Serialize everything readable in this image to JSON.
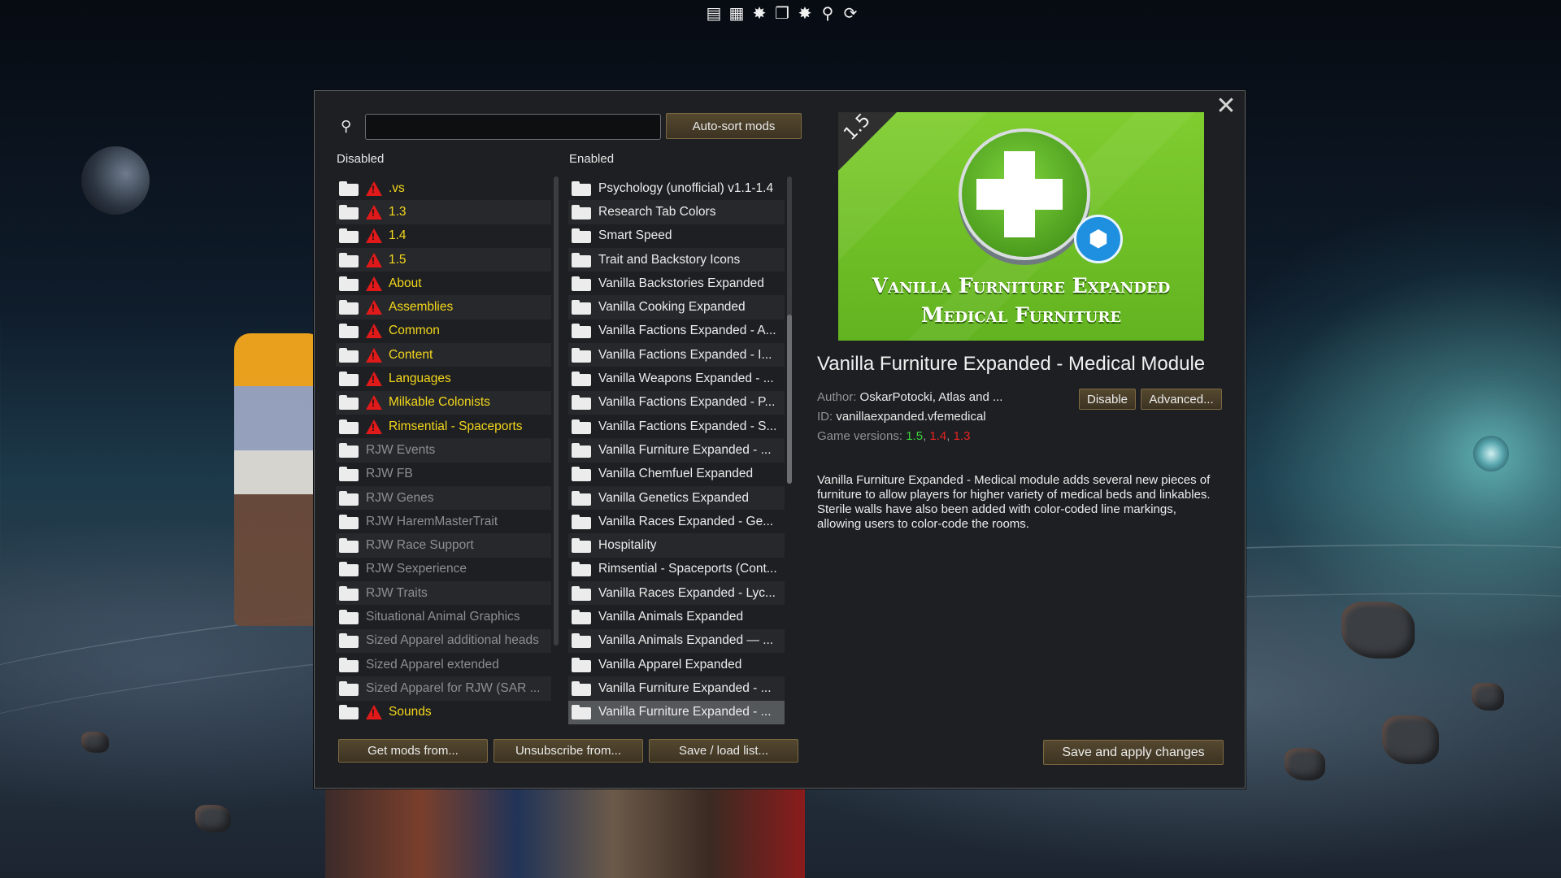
{
  "top_toolbar": {
    "icons": [
      "list-icon",
      "grid-icon",
      "gear-burst-icon",
      "copy-icon",
      "gear-burst-icon",
      "search-icon",
      "refresh-icon"
    ]
  },
  "search": {
    "value": "",
    "placeholder": ""
  },
  "buttons": {
    "auto_sort": "Auto-sort mods",
    "get_mods": "Get mods from...",
    "unsubscribe": "Unsubscribe from...",
    "save_load": "Save / load list...",
    "disable": "Disable",
    "advanced": "Advanced...",
    "save_apply": "Save and apply changes"
  },
  "columns": {
    "disabled_header": "Disabled",
    "enabled_header": "Enabled"
  },
  "disabled_mods": [
    {
      "name": ".vs",
      "warning": true
    },
    {
      "name": "1.3",
      "warning": true
    },
    {
      "name": "1.4",
      "warning": true
    },
    {
      "name": "1.5",
      "warning": true
    },
    {
      "name": "About",
      "warning": true
    },
    {
      "name": "Assemblies",
      "warning": true
    },
    {
      "name": "Common",
      "warning": true
    },
    {
      "name": "Content",
      "warning": true
    },
    {
      "name": "Languages",
      "warning": true
    },
    {
      "name": "Milkable Colonists",
      "warning": true
    },
    {
      "name": "Rimsential - Spaceports",
      "warning": true
    },
    {
      "name": "RJW Events",
      "warning": false
    },
    {
      "name": "RJW FB",
      "warning": false
    },
    {
      "name": "RJW Genes",
      "warning": false
    },
    {
      "name": "RJW HaremMasterTrait",
      "warning": false
    },
    {
      "name": "RJW Race Support",
      "warning": false
    },
    {
      "name": "RJW Sexperience",
      "warning": false
    },
    {
      "name": "RJW Traits",
      "warning": false
    },
    {
      "name": "Situational Animal Graphics",
      "warning": false
    },
    {
      "name": "Sized Apparel additional heads",
      "warning": false
    },
    {
      "name": "Sized Apparel extended",
      "warning": false
    },
    {
      "name": "Sized Apparel for RJW (SAR ...",
      "warning": false
    },
    {
      "name": "Sounds",
      "warning": true
    }
  ],
  "enabled_mods": [
    {
      "name": "Psychology (unofficial) v1.1-1.4"
    },
    {
      "name": "Research Tab Colors"
    },
    {
      "name": "Smart Speed"
    },
    {
      "name": "Trait and Backstory Icons"
    },
    {
      "name": "Vanilla Backstories Expanded"
    },
    {
      "name": "Vanilla Cooking Expanded"
    },
    {
      "name": "Vanilla Factions Expanded - A..."
    },
    {
      "name": "Vanilla Factions Expanded - I..."
    },
    {
      "name": "Vanilla Weapons Expanded - ..."
    },
    {
      "name": "Vanilla Factions Expanded - P..."
    },
    {
      "name": "Vanilla Factions Expanded - S..."
    },
    {
      "name": "Vanilla Furniture Expanded - ..."
    },
    {
      "name": "Vanilla Chemfuel Expanded"
    },
    {
      "name": "Vanilla Genetics Expanded"
    },
    {
      "name": "Vanilla Races Expanded - Ge..."
    },
    {
      "name": "Hospitality"
    },
    {
      "name": "Rimsential - Spaceports (Cont..."
    },
    {
      "name": "Vanilla Races Expanded - Lyc..."
    },
    {
      "name": "Vanilla Animals Expanded"
    },
    {
      "name": "Vanilla Animals Expanded — ..."
    },
    {
      "name": "Vanilla Apparel Expanded"
    },
    {
      "name": "Vanilla Furniture Expanded - ..."
    },
    {
      "name": "Vanilla Furniture Expanded - ...",
      "selected": true
    }
  ],
  "preview": {
    "version_badge": "1.5",
    "title_line1": "Vanilla Furniture Expanded",
    "title_line2": "Medical Furniture"
  },
  "details": {
    "title": "Vanilla Furniture Expanded - Medical Module",
    "author_label": "Author:",
    "author_value": "OskarPotocki, Atlas and ...",
    "id_label": "ID:",
    "id_value": "vanillaexpanded.vfemedical",
    "versions_label": "Game versions:",
    "versions": [
      {
        "v": "1.5",
        "color": "#3bd13b"
      },
      {
        "v": "1.4",
        "color": "#e82323"
      },
      {
        "v": "1.3",
        "color": "#e82323"
      }
    ],
    "description": "Vanilla Furniture Expanded - Medical module adds several new pieces of furniture to allow players for higher variety of medical beds and linkables. Sterile walls have also been added with color-coded line markings, allowing users to color-code the rooms."
  },
  "colors": {
    "warning_text": "#f4d71c",
    "warning_icon": "#e01a1a",
    "dim_text": "#8c8f93",
    "button_border": "#7d6a42"
  }
}
